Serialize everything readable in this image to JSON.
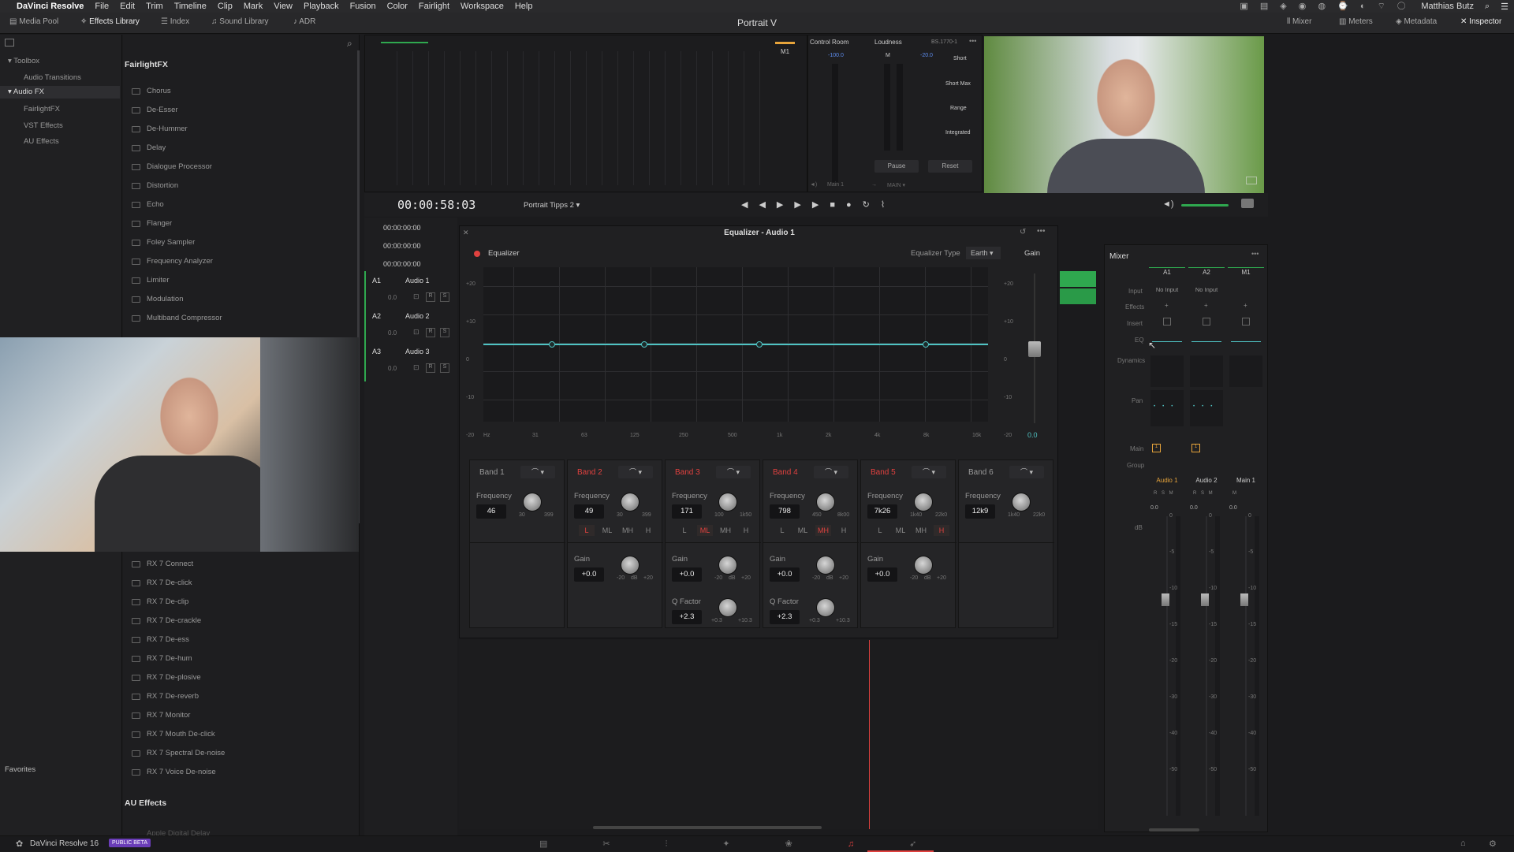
{
  "menubar": {
    "apple": "",
    "app": "DaVinci Resolve",
    "items": [
      "File",
      "Edit",
      "Trim",
      "Timeline",
      "Clip",
      "Mark",
      "View",
      "Playback",
      "Fusion",
      "Color",
      "Fairlight",
      "Workspace",
      "Help"
    ],
    "user": "Matthias Butz"
  },
  "toolbar": {
    "media_pool": "Media Pool",
    "effects_library": "Effects Library",
    "index": "Index",
    "sound_library": "Sound Library",
    "adr": "ADR",
    "mixer": "Mixer",
    "meters": "Meters",
    "metadata": "Metadata",
    "inspector": "Inspector"
  },
  "project_title": "Portrait V",
  "tree": {
    "toolbox": "Toolbox",
    "audio_transitions": "Audio Transitions",
    "audio_fx": "Audio FX",
    "fairlightfx": "FairlightFX",
    "vst": "VST Effects",
    "au": "AU Effects",
    "favorites": "Favorites"
  },
  "fxlist": {
    "header": "FairlightFX",
    "items": [
      "Chorus",
      "De-Esser",
      "De-Hummer",
      "Delay",
      "Dialogue Processor",
      "Distortion",
      "Echo",
      "Flanger",
      "Foley Sampler",
      "Frequency Analyzer",
      "Limiter",
      "Modulation",
      "Multiband Compressor"
    ],
    "rx_items": [
      "RX 7 Connect",
      "RX 7 De-click",
      "RX 7 De-clip",
      "RX 7 De-crackle",
      "RX 7 De-ess",
      "RX 7 De-hum",
      "RX 7 De-plosive",
      "RX 7 De-reverb",
      "RX 7 Monitor",
      "RX 7 Mouth De-click",
      "RX 7 Spectral De-noise",
      "RX 7 Voice De-noise"
    ],
    "au_header": "AU Effects",
    "au_item": "Apple Digital Delay"
  },
  "control_room": {
    "title": "Control Room",
    "loudness": "Loudness",
    "bs": "BS.1770-1",
    "m1": "M1",
    "m": "M",
    "val_left": "-100.0",
    "val_right": "-20.0",
    "short": "Short",
    "short_max": "Short Max",
    "range": "Range",
    "integrated": "Integrated",
    "pause": "Pause",
    "reset": "Reset",
    "main1": "Main 1",
    "main": "MAIN"
  },
  "transport": {
    "timecode": "00:00:58:03",
    "timeline": "Portrait Tipps 2",
    "tc1": "00:00:00:00",
    "tc2": "00:00:00:00",
    "tc3": "00:00:00:00"
  },
  "tracks": [
    {
      "id": "A1",
      "name": "Audio 1",
      "level": "0.0"
    },
    {
      "id": "A2",
      "name": "Audio 2",
      "level": "0.0"
    },
    {
      "id": "A3",
      "name": "Audio 3",
      "level": "0.0"
    }
  ],
  "eq": {
    "window_title": "Equalizer - Audio 1",
    "label": "Equalizer",
    "type_label": "Equalizer Type",
    "type_value": "Earth",
    "gain": "Gain",
    "gain_value": "0.0",
    "y_ticks": [
      "+20",
      "+10",
      "0",
      "-10",
      "-20"
    ],
    "x_ticks": [
      "Hz",
      "31",
      "63",
      "125",
      "250",
      "500",
      "1k",
      "2k",
      "4k",
      "8k",
      "16k"
    ],
    "bands": [
      {
        "name": "Band 1",
        "active": false,
        "freq_label": "Frequency",
        "freq": "46",
        "min": "30",
        "max": "399"
      },
      {
        "name": "Band 2",
        "active": true,
        "freq_label": "Frequency",
        "freq": "49",
        "min": "30",
        "max": "399",
        "gain_label": "Gain",
        "gain": "+0.0",
        "gmin": "-20",
        "gmid": "dB",
        "gmax": "+20"
      },
      {
        "name": "Band 3",
        "active": true,
        "freq_label": "Frequency",
        "freq": "171",
        "min": "100",
        "max": "1k50",
        "gain_label": "Gain",
        "gain": "+0.0",
        "gmin": "-20",
        "gmid": "dB",
        "gmax": "+20",
        "q_label": "Q Factor",
        "q": "+2.3",
        "qmin": "+0.3",
        "qmax": "+10.3"
      },
      {
        "name": "Band 4",
        "active": true,
        "freq_label": "Frequency",
        "freq": "798",
        "min": "450",
        "max": "8k00",
        "gain_label": "Gain",
        "gain": "+0.0",
        "gmin": "-20",
        "gmid": "dB",
        "gmax": "+20",
        "q_label": "Q Factor",
        "q": "+2.3",
        "qmin": "+0.3",
        "qmax": "+10.3"
      },
      {
        "name": "Band 5",
        "active": true,
        "freq_label": "Frequency",
        "freq": "7k26",
        "min": "1k40",
        "max": "22k0",
        "gain_label": "Gain",
        "gain": "+0.0",
        "gmin": "-20",
        "gmid": "dB",
        "gmax": "+20"
      },
      {
        "name": "Band 6",
        "active": false,
        "freq_label": "Frequency",
        "freq": "12k9",
        "min": "1k40",
        "max": "22k0"
      }
    ],
    "filters": [
      "L",
      "ML",
      "MH",
      "H"
    ]
  },
  "mixer": {
    "title": "Mixer",
    "cols": [
      "A1",
      "A2",
      "M1"
    ],
    "input": "Input",
    "no_input": "No Input",
    "effects": "Effects",
    "insert": "Insert",
    "eq": "EQ",
    "dynamics": "Dynamics",
    "pan": "Pan",
    "main": "Main",
    "group": "Group",
    "strip_names": [
      "Audio 1",
      "Audio 2",
      "Main 1"
    ],
    "levels": [
      "0.0",
      "0.0",
      "0.0"
    ],
    "db": "dB",
    "scale": [
      "0",
      "-5",
      "-10",
      "-15",
      "-20",
      "-30",
      "-40",
      "-50"
    ]
  },
  "statusbar": {
    "app": "DaVinci Resolve 16",
    "beta": "PUBLIC BETA"
  },
  "colors": {
    "accent_red": "#e0413f",
    "teal": "#4fc3c3",
    "green": "#2fa84f",
    "orange": "#e7a43b"
  }
}
